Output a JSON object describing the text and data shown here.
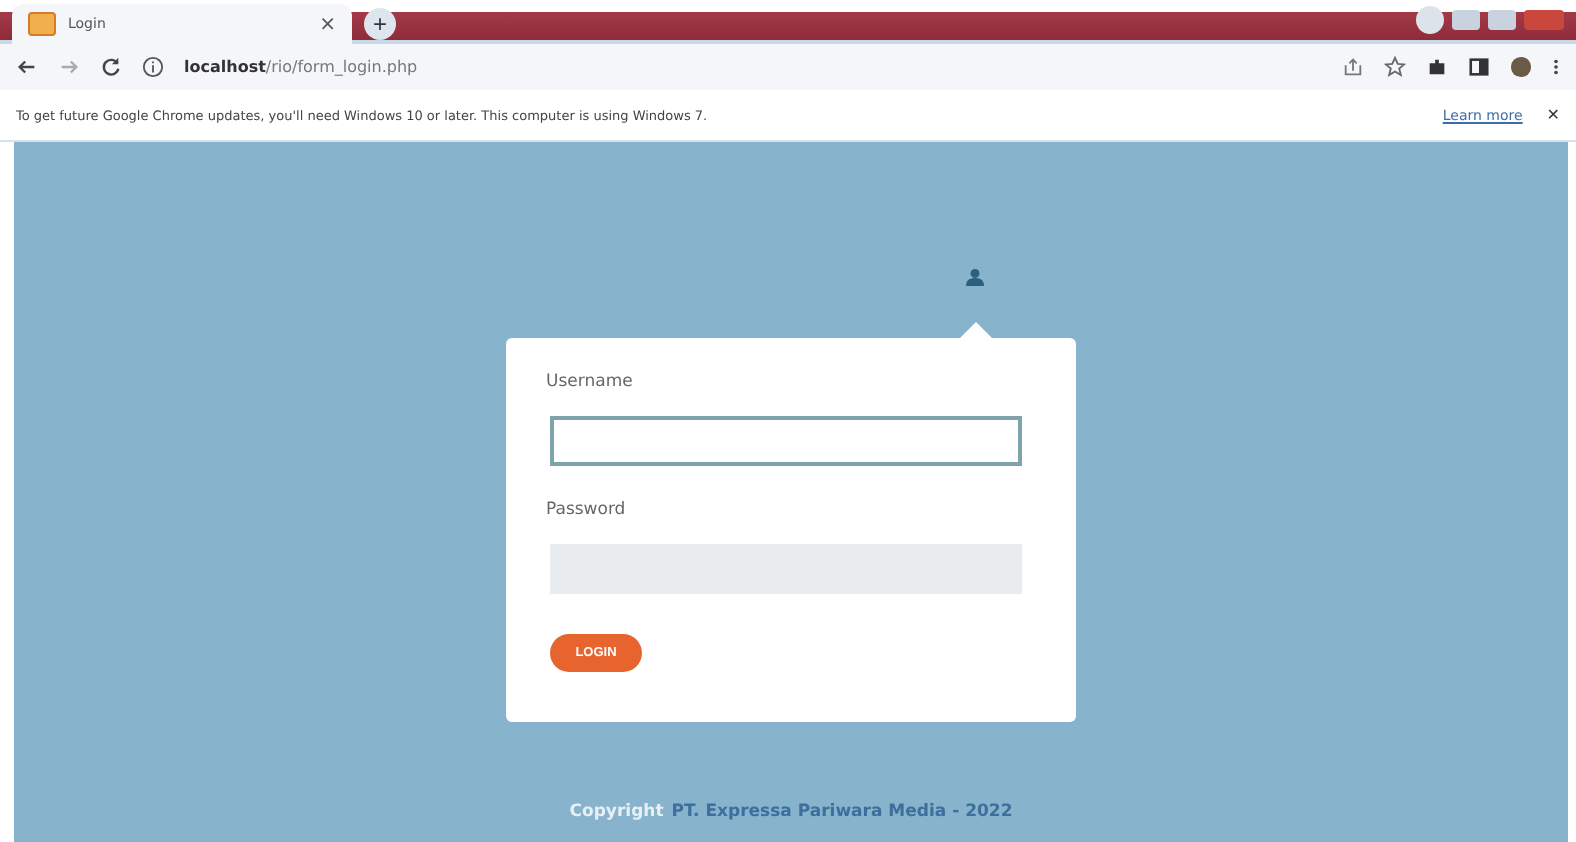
{
  "tab": {
    "title": "Login",
    "close": "×",
    "new_tab": "+"
  },
  "address_bar": {
    "url": "**localhost**/rio/form_login.php"
  },
  "info_bar": {
    "message": "To get future Google Chrome updates, you'll need Windows 10 or later. This computer is using Windows 7.",
    "link": "Learn more",
    "close": "✕"
  },
  "login_form": {
    "fields": [
      {
        "label": "Username",
        "focused": true
      },
      {
        "label": "Password",
        "focused": false
      }
    ],
    "button": "LOGIN"
  },
  "footer": {
    "prefix": "Copyright",
    "owner": "PT. Expressa Pariwara Media - 2022"
  }
}
